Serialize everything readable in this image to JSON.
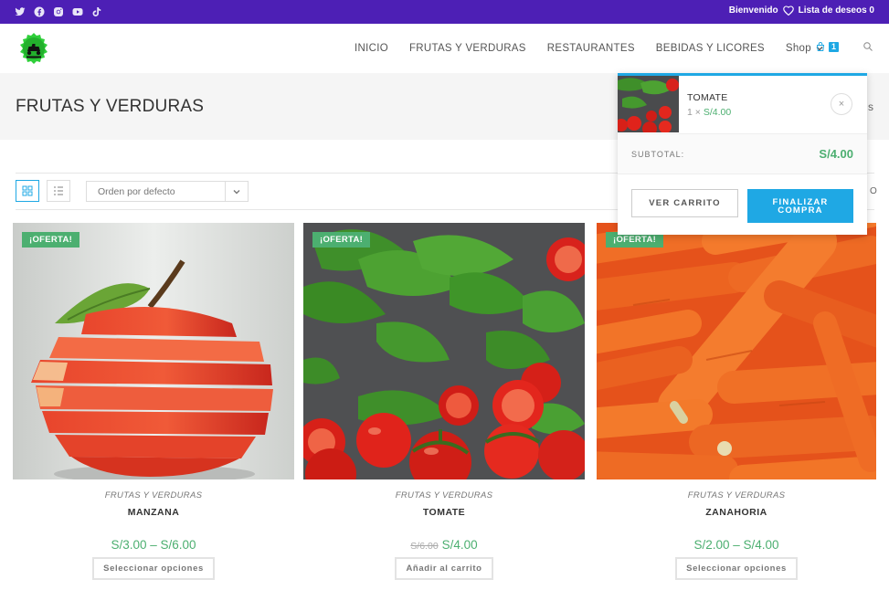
{
  "topbar": {
    "social_icons": [
      "twitter-icon",
      "facebook-icon",
      "instagram-icon",
      "youtube-icon",
      "tiktok-icon"
    ],
    "welcome_text": "Bienvenido",
    "wishlist_text": "Lista de deseos 0",
    "bg_color": "#4d1fb5"
  },
  "header": {
    "nav": [
      {
        "label": "INICIO"
      },
      {
        "label": "FRUTAS Y VERDURAS"
      },
      {
        "label": "RESTAURANTES"
      },
      {
        "label": "BEBIDAS Y LICORES"
      }
    ],
    "shop_label": "Shop",
    "cart_count": "1"
  },
  "page": {
    "title": "FRUTAS Y VERDURAS",
    "breadcrumb_peek": "s"
  },
  "toolbar": {
    "sort_value": "Orden por defecto",
    "result_peek": "O"
  },
  "products": [
    {
      "badge": "¡OFERTA!",
      "category": "FRUTAS Y VERDURAS",
      "name": "MANZANA",
      "old_price": "",
      "price": "S/3.00 – S/6.00",
      "button": "Seleccionar opciones"
    },
    {
      "badge": "¡OFERTA!",
      "category": "FRUTAS Y VERDURAS",
      "name": "TOMATE",
      "old_price": "S/6.00",
      "price": "S/4.00",
      "button": "Añadir al carrito"
    },
    {
      "badge": "¡OFERTA!",
      "category": "FRUTAS Y VERDURAS",
      "name": "ZANAHORIA",
      "old_price": "",
      "price": "S/2.00 – S/4.00",
      "button": "Seleccionar opciones"
    }
  ],
  "minicart": {
    "item_name": "TOMATE",
    "item_qty": "1",
    "item_times": "×",
    "item_price": "S/4.00",
    "remove": "×",
    "subtotal_label": "SUBTOTAL:",
    "subtotal_value": "S/4.00",
    "view_cart": "VER CARRITO",
    "checkout": "FINALIZAR COMPRA"
  },
  "colors": {
    "accent": "#1fa8e4",
    "price_green": "#4caf70",
    "badge_green": "#4caf70"
  }
}
